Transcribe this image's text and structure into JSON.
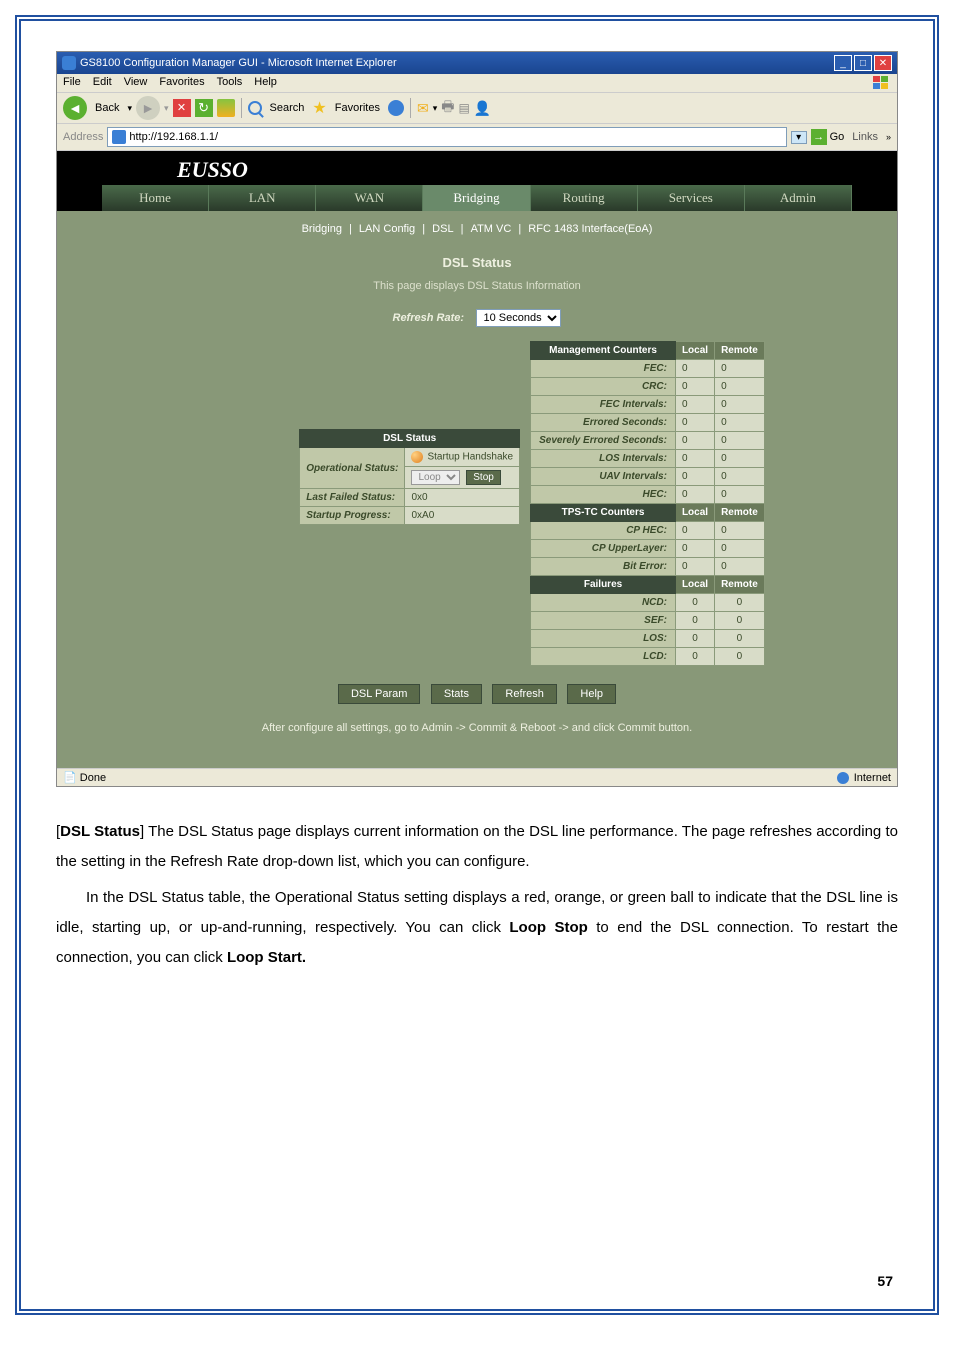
{
  "browser": {
    "title": "GS8100 Configuration Manager GUI - Microsoft Internet Explorer",
    "menus": [
      "File",
      "Edit",
      "View",
      "Favorites",
      "Tools",
      "Help"
    ],
    "toolbar": {
      "back": "Back",
      "search": "Search",
      "favorites": "Favorites"
    },
    "address_label": "Address",
    "url": "http://192.168.1.1/",
    "go": "Go",
    "links": "Links",
    "status_done": "Done",
    "status_zone": "Internet"
  },
  "logo": "EUSSO",
  "top_nav": [
    "Home",
    "LAN",
    "WAN",
    "Bridging",
    "Routing",
    "Services",
    "Admin"
  ],
  "sub_nav": [
    "Bridging",
    "LAN Config",
    "DSL",
    "ATM VC",
    "RFC 1483 Interface(EoA)"
  ],
  "section_title": "DSL Status",
  "section_desc": "This page displays DSL Status Information",
  "refresh_label": "Refresh Rate:",
  "refresh_value": "10 Seconds",
  "dsl_status": {
    "header": "DSL Status",
    "rows": {
      "op_status_label": "Operational Status:",
      "op_status_text": "Startup Handshake",
      "loop_label": "Loop",
      "stop_label": "Stop",
      "last_failed_label": "Last Failed Status:",
      "last_failed_val": "0x0",
      "startup_prog_label": "Startup Progress:",
      "startup_prog_val": "0xA0"
    }
  },
  "counters": {
    "mgmt_header": "Management Counters",
    "local": "Local",
    "remote": "Remote",
    "mgmt_rows": [
      {
        "label": "FEC:",
        "local": "0",
        "remote": "0"
      },
      {
        "label": "CRC:",
        "local": "0",
        "remote": "0"
      },
      {
        "label": "FEC Intervals:",
        "local": "0",
        "remote": "0"
      },
      {
        "label": "Errored Seconds:",
        "local": "0",
        "remote": "0"
      },
      {
        "label": "Severely Errored Seconds:",
        "local": "0",
        "remote": "0"
      },
      {
        "label": "LOS Intervals:",
        "local": "0",
        "remote": "0"
      },
      {
        "label": "UAV Intervals:",
        "local": "0",
        "remote": "0"
      },
      {
        "label": "HEC:",
        "local": "0",
        "remote": "0"
      }
    ],
    "tps_header": "TPS-TC Counters",
    "tps_rows": [
      {
        "label": "CP HEC:",
        "local": "0",
        "remote": "0"
      },
      {
        "label": "CP UpperLayer:",
        "local": "0",
        "remote": "0"
      },
      {
        "label": "Bit Error:",
        "local": "0",
        "remote": "0"
      }
    ],
    "fail_header": "Failures",
    "fail_rows": [
      {
        "label": "NCD:",
        "local": "0",
        "remote": "0"
      },
      {
        "label": "SEF:",
        "local": "0",
        "remote": "0"
      },
      {
        "label": "LOS:",
        "local": "0",
        "remote": "0"
      },
      {
        "label": "LCD:",
        "local": "0",
        "remote": "0"
      }
    ]
  },
  "buttons": {
    "dsl_param": "DSL Param",
    "stats": "Stats",
    "refresh": "Refresh",
    "help": "Help"
  },
  "commit_note": "After configure all settings, go to Admin -> Commit & Reboot -> and click Commit button.",
  "body": {
    "p1_label": "DSL Status",
    "p1": "] The DSL Status page displays current information on the DSL line performance. The page refreshes according to the setting in the Refresh Rate drop-down list, which you can configure.",
    "p2a": "In the DSL Status table, the Operational Status setting displays a red, orange, or green ball to indicate that the DSL line is idle, starting up, or up-and-running, respectively. You can click ",
    "p2b": "Loop Stop",
    "p2c": " to end the DSL connection. To restart the connection, you can click ",
    "p2d": "Loop Start."
  },
  "page_number": "57"
}
